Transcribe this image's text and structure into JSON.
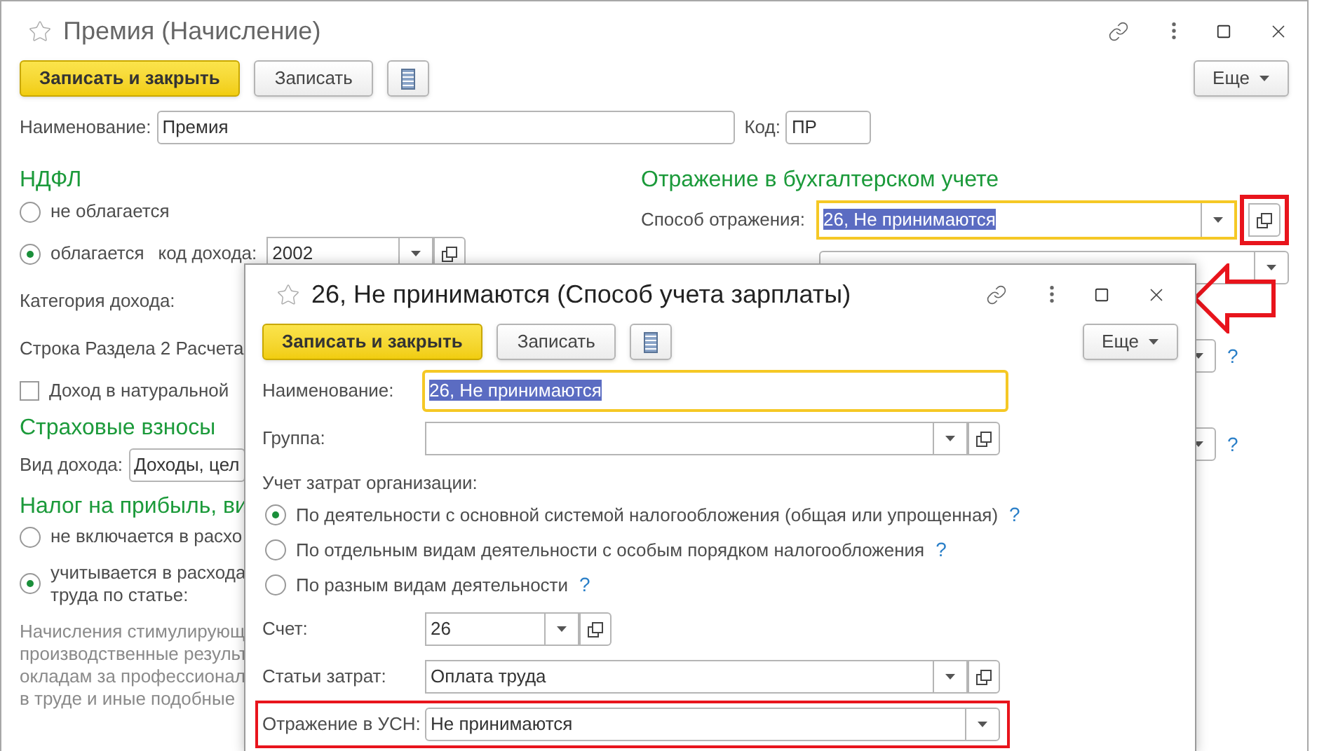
{
  "main": {
    "title": "Премия (Начисление)",
    "toolbar": {
      "primary": "Записать и закрыть",
      "save": "Записать",
      "more": "Еще"
    },
    "name": {
      "label": "Наименование:",
      "value": "Премия"
    },
    "code": {
      "label": "Код:",
      "value": "ПР"
    },
    "ndfl": {
      "heading": "НДФЛ",
      "options": [
        {
          "label": "не облагается",
          "selected": false
        },
        {
          "label": "облагается",
          "selected": true
        }
      ],
      "income_code": {
        "label": "код дохода:",
        "value": "2002",
        "kind": "select_open"
      },
      "category_label": "Категория дохода:",
      "report_row_label": "Строка Раздела 2 Расчета",
      "in_kind": {
        "label": "Доход в натуральной",
        "checked": false
      }
    },
    "insurance": {
      "heading": "Страховые взносы",
      "income_type": {
        "label": "Вид дохода:",
        "value": "Доходы, цел"
      }
    },
    "profit_tax": {
      "heading": "Налог на прибыль, ви",
      "options": [
        {
          "lines": [
            "не включается в расхо"
          ],
          "selected": false
        },
        {
          "lines": [
            "учитывается в расхода",
            "труда по статье:"
          ],
          "selected": true
        }
      ],
      "note": [
        "Начисления стимулирующ",
        "производственные результ",
        "окладам за профессионал",
        "в труде и иные подобные"
      ]
    },
    "accounting": {
      "heading": "Отражение в бухгалтерском учете",
      "method": {
        "label": "Способ отражения:",
        "value": "26, Не принимаются",
        "kind": "select_open",
        "focused": true,
        "text_selected": true,
        "open_annotated": true
      },
      "help_marks": [
        "?",
        "?"
      ]
    }
  },
  "dialog": {
    "title": "26, Не принимаются (Способ учета зарплаты)",
    "toolbar": {
      "primary": "Записать и закрыть",
      "save": "Записать",
      "more": "Еще"
    },
    "fields_top": [
      {
        "kind": "text",
        "label": "Наименование:",
        "value": "26, Не принимаются",
        "focused": true,
        "text_selected": true
      },
      {
        "kind": "select_open",
        "label": "Группа:",
        "focused": false
      }
    ],
    "cost_accounting": {
      "label": "Учет затрат организации:",
      "options": [
        {
          "label": "По деятельности с основной системой налогообложения (общая или упрощенная)",
          "help": "?",
          "selected": true
        },
        {
          "label": "По отдельным видам деятельности с особым порядком налогообложения",
          "help": "?",
          "selected": false
        },
        {
          "label": "По разным видам деятельности",
          "help": "?",
          "selected": false
        }
      ]
    },
    "fields_bottom": [
      {
        "kind": "select_open",
        "label": "Счет:",
        "value": "26",
        "short": true,
        "focused": false,
        "text_selected": false,
        "annotated": false
      },
      {
        "kind": "select_open",
        "label": "Статьи затрат:",
        "value": "Оплата труда",
        "short": false,
        "focused": false,
        "text_selected": false,
        "annotated": false
      },
      {
        "kind": "select",
        "label": "Отражение в УСН:",
        "value": "Не принимаются",
        "short": false,
        "focused": false,
        "text_selected": false,
        "annotated": true
      }
    ]
  }
}
